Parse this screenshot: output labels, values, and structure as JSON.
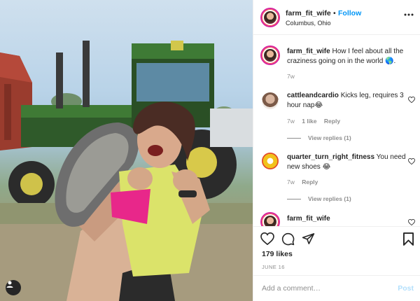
{
  "post": {
    "username": "farm_fit_wife",
    "separator": "•",
    "follow_label": "Follow",
    "location": "Columbus, Ohio"
  },
  "caption": {
    "username": "farm_fit_wife",
    "text": "How I feel about all the craziness going on in the world 🌎.",
    "age": "7w"
  },
  "comments": [
    {
      "username": "cattleandcardio",
      "text": "Kicks leg, requires 3 hour nap😂",
      "age": "7w",
      "likes": "1 like",
      "reply_label": "Reply",
      "view_replies": "View replies (1)"
    },
    {
      "username": "quarter_turn_right_fitness",
      "text": "You need new shoes 😂",
      "age": "7w",
      "reply_label": "Reply",
      "view_replies": "View replies (1)"
    },
    {
      "username": "farm_fit_wife",
      "text": ""
    }
  ],
  "actions": {
    "likes": "179 likes",
    "date": "JUNE 16"
  },
  "add_comment": {
    "placeholder": "Add a comment…",
    "post_label": "Post"
  },
  "colors": {
    "follow": "#0095f6",
    "post_disabled": "#b2dffc",
    "muted": "#8e8e8e",
    "text": "#262626"
  },
  "icons": [
    "more-horizontal-icon",
    "heart-icon",
    "comment-icon",
    "share-icon",
    "bookmark-icon",
    "user-tag-icon"
  ]
}
